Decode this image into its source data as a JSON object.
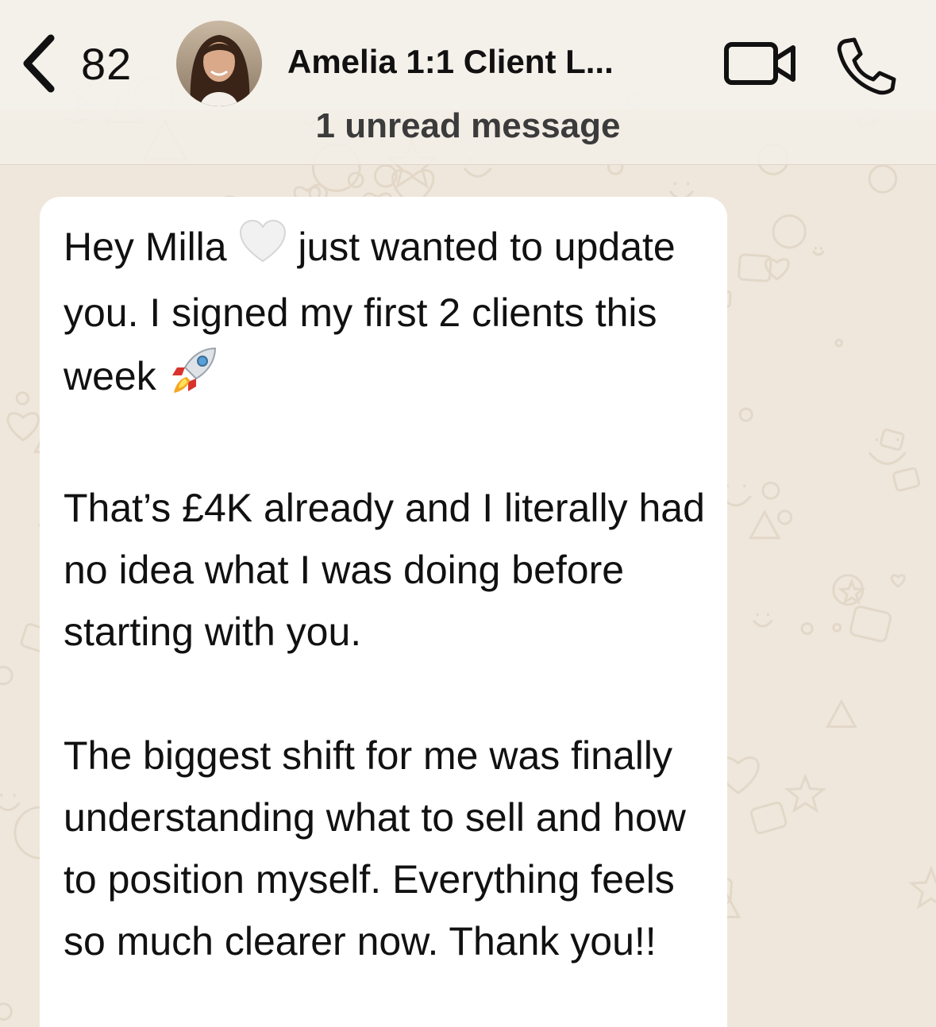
{
  "header": {
    "back_count": "82",
    "chat_title": "Amelia 1:1 Client L...",
    "icons": {
      "back": "chevron-left-icon",
      "video": "video-camera-icon",
      "call": "phone-icon"
    }
  },
  "banner": {
    "unread": "1 unread message"
  },
  "message": {
    "p1_part1": "Hey Milla",
    "p1_emoji": "white-heart-icon",
    "p1_part2": " just wanted to update you. I signed my first 2 clients this week",
    "p1_emoji2": "rocket-icon",
    "p2": "That’s £4K already and I literally had no idea what I was doing before starting with you.",
    "p3": "The biggest shift for me was finally understanding what to sell and how to position myself. Everything feels so much clearer now. Thank you!!"
  },
  "colors": {
    "wallpaper": "#efe7dc",
    "doodle": "#e3d8c8",
    "bubble": "#ffffff",
    "header": "#f4f0ea"
  }
}
